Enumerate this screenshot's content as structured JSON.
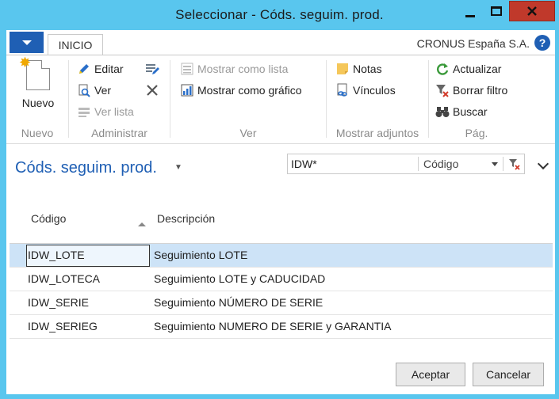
{
  "window": {
    "title": "Seleccionar - Códs. seguim. prod."
  },
  "ribbon": {
    "tab": "INICIO",
    "company": "CRONUS España S.A.",
    "help": "?",
    "groups": {
      "nuevo": {
        "label": "Nuevo",
        "new_button": "Nuevo"
      },
      "administrar": {
        "label": "Administrar",
        "edit": "Editar",
        "view": "Ver",
        "view_list": "Ver lista"
      },
      "ver": {
        "label": "Ver",
        "show_list": "Mostrar como lista",
        "show_chart": "Mostrar como gráfico"
      },
      "adjuntos": {
        "label": "Mostrar adjuntos",
        "notes": "Notas",
        "links": "Vínculos"
      },
      "pag": {
        "label": "Pág.",
        "refresh": "Actualizar",
        "clear_filter": "Borrar filtro",
        "find": "Buscar"
      }
    }
  },
  "page": {
    "title": "Códs. seguim. prod.",
    "filter": {
      "value": "IDW*",
      "field": "Código"
    }
  },
  "table": {
    "headers": {
      "code": "Código",
      "description": "Descripción"
    },
    "rows": [
      {
        "code": "IDW_LOTE",
        "description": "Seguimiento LOTE"
      },
      {
        "code": "IDW_LOTECA",
        "description": "Seguimiento LOTE y CADUCIDAD"
      },
      {
        "code": "IDW_SERIE",
        "description": "Seguimiento NÚMERO DE SERIE"
      },
      {
        "code": "IDW_SERIEG",
        "description": "Seguimiento NUMERO DE SERIE y GARANTIA"
      }
    ]
  },
  "footer": {
    "ok": "Aceptar",
    "cancel": "Cancelar"
  }
}
